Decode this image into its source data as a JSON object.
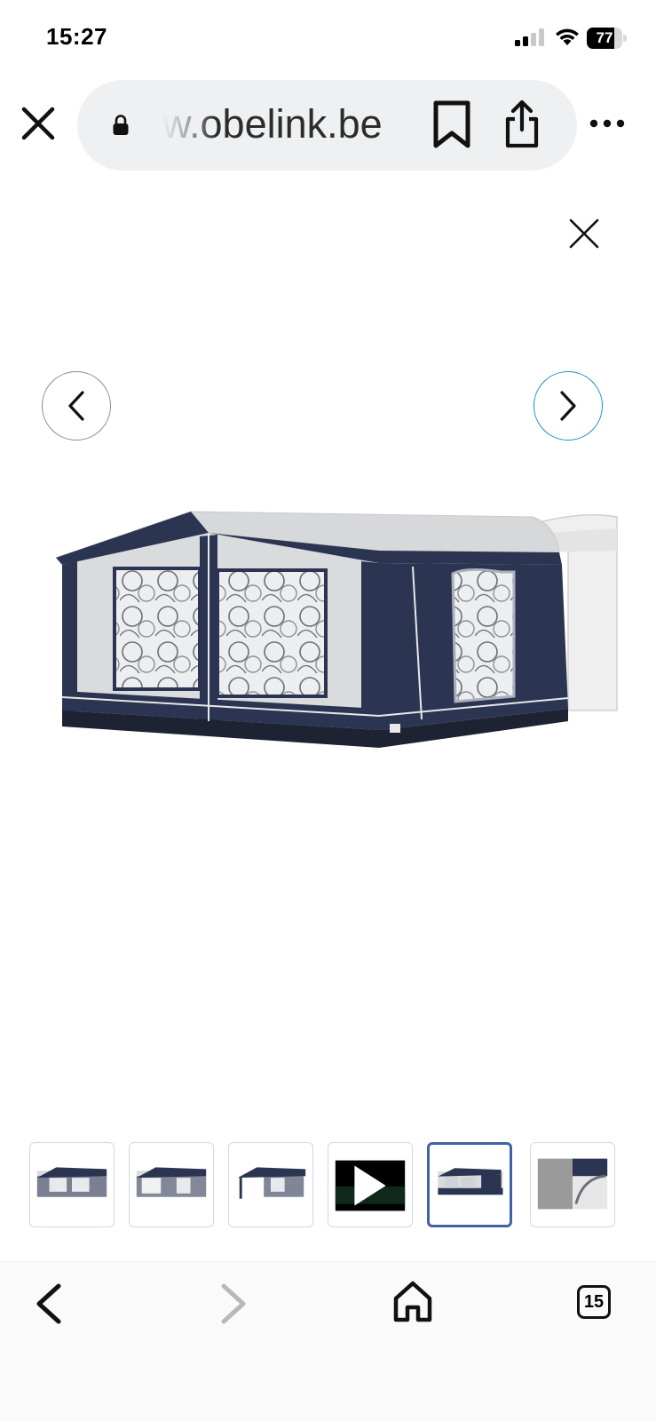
{
  "status_bar": {
    "time": "15:27",
    "battery_percent": 77,
    "battery_label": "77",
    "signal_bars": 2,
    "icons": [
      "signal-icon",
      "wifi-icon",
      "battery-icon"
    ]
  },
  "browser": {
    "url_display": "w.obelink.be",
    "icons": {
      "close": "close-icon",
      "lock": "lock-icon",
      "bookmark": "bookmark-icon",
      "share": "share-icon",
      "more": "more-icon"
    }
  },
  "gallery": {
    "icons": {
      "close": "close-icon",
      "prev": "chevron-left-icon",
      "next": "chevron-right-icon"
    },
    "thumbnails": [
      {
        "kind": "image"
      },
      {
        "kind": "image"
      },
      {
        "kind": "image"
      },
      {
        "kind": "video"
      },
      {
        "kind": "image",
        "active": true
      },
      {
        "kind": "image"
      }
    ],
    "active_index": 4,
    "colors": {
      "tent_navy": "#2b3552",
      "tent_grey": "#d9dbdd",
      "active_border": "#3f63a6",
      "next_button": "#1a8cc4"
    }
  },
  "toolbar": {
    "tab_count": "15",
    "icons": {
      "back": "back-icon",
      "forward": "forward-icon",
      "home": "home-icon",
      "tabs": "tabs-icon"
    }
  }
}
